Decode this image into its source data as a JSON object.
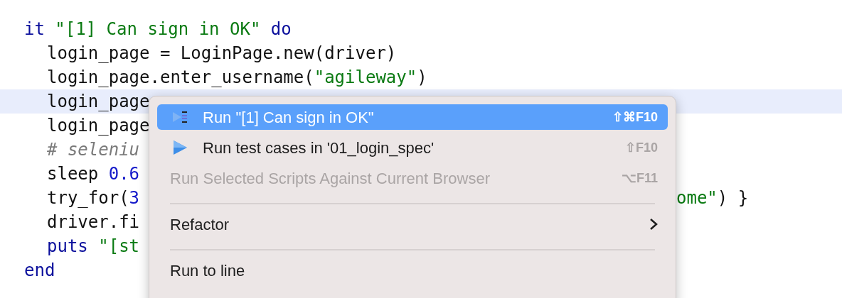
{
  "code": {
    "lines": [
      {
        "highlighted": false,
        "tokens": [
          {
            "text": "it ",
            "kind": "keyword"
          },
          {
            "text": "\"[1] Can sign in OK\"",
            "kind": "string"
          },
          {
            "text": " do",
            "kind": "keyword"
          }
        ],
        "children": [
          {
            "highlighted": false,
            "tokens": [
              {
                "text": "login_page = LoginPage.new(driver)",
                "kind": "plain"
              }
            ]
          },
          {
            "highlighted": false,
            "tokens": [
              {
                "text": "login_page.enter_username(",
                "kind": "plain"
              },
              {
                "text": "\"agileway\"",
                "kind": "string"
              },
              {
                "text": ")",
                "kind": "plain"
              }
            ]
          },
          {
            "highlighted": true,
            "tokens": [
              {
                "text": "login_page",
                "kind": "plain"
              }
            ]
          },
          {
            "highlighted": false,
            "tokens": [
              {
                "text": "login_page",
                "kind": "plain"
              }
            ]
          },
          {
            "highlighted": false,
            "tokens": [
              {
                "text": "# seleniu",
                "kind": "comment"
              }
            ]
          },
          {
            "highlighted": false,
            "tokens": [
              {
                "text": "sleep ",
                "kind": "plain"
              },
              {
                "text": "0.6",
                "kind": "number"
              }
            ]
          },
          {
            "highlighted": false,
            "tokens": [
              {
                "text": "try_for(",
                "kind": "plain"
              },
              {
                "text": "3",
                "kind": "number"
              }
            ],
            "tail": [
              {
                "text": "ome\"",
                "kind": "string"
              },
              {
                "text": ") }",
                "kind": "plain"
              }
            ]
          },
          {
            "highlighted": false,
            "tokens": [
              {
                "text": "driver.fi",
                "kind": "plain"
              }
            ]
          },
          {
            "highlighted": false,
            "tokens": [
              {
                "text": "puts ",
                "kind": "keyword"
              },
              {
                "text": "\"[st",
                "kind": "string"
              }
            ]
          }
        ]
      },
      {
        "highlighted": false,
        "tokens": [
          {
            "text": "end",
            "kind": "keyword"
          }
        ]
      }
    ]
  },
  "context_menu": {
    "items": [
      {
        "kind": "run-test",
        "label": "Run \"[1] Can sign in OK\"",
        "shortcut": "⇧⌘F10",
        "selected": true,
        "disabled": false
      },
      {
        "kind": "run-file",
        "label": "Run test cases in '01_login_spec'",
        "shortcut": "⇧F10",
        "selected": false,
        "disabled": false
      },
      {
        "kind": "command",
        "label": "Run Selected Scripts Against Current Browser",
        "shortcut": "⌥F11",
        "selected": false,
        "disabled": true
      },
      {
        "kind": "separator"
      },
      {
        "kind": "submenu",
        "label": "Refactor",
        "selected": false,
        "disabled": false
      },
      {
        "kind": "separator"
      },
      {
        "kind": "command",
        "label": "Run to line",
        "selected": false,
        "disabled": false
      }
    ]
  }
}
